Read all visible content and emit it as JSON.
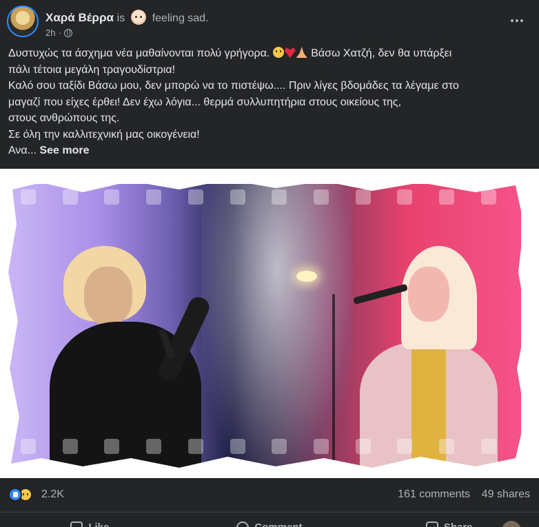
{
  "post": {
    "author": "Χαρά Βέρρα",
    "is_text": "is",
    "feeling_icon": "pleading-face",
    "feeling": "feeling sad.",
    "time": "2h",
    "privacy_icon": "globe-icon",
    "more_icon": "more-dots-icon",
    "text": {
      "line1a": "Δυστυχώς τα άσχημα νέα μαθαίνονται πολύ γρήγορα.",
      "line1b": "Βάσω Χατζή, δεν θα υπάρξει",
      "line2": "πάλι τέτοια μεγάλη τραγουδίστρια!",
      "line3": "Καλό σου ταξίδι Βάσω μου, δεν μπορώ να το πιστέψω.... Πριν λίγες βδομάδες τα λέγαμε στο",
      "line4": "μαγαζί που είχες έρθει! Δεν έχω λόγια... θερμά συλλυπητήρια στους οικείους της,",
      "line5": "στους ανθρώπους της.",
      "line6": "Σε όλη την καλλιτεχνική μας οικογένεια!",
      "line7": "Ανα...",
      "see_more": "See more"
    }
  },
  "stats": {
    "reactions": "2.2K",
    "reaction_types": [
      "like",
      "sad"
    ],
    "comments": "161 comments",
    "shares": "49 shares"
  },
  "actions": {
    "like": "Like",
    "comment": "Comment",
    "share": "Share"
  },
  "colors": {
    "background": "#242526",
    "text_primary": "#e4e6eb",
    "text_secondary": "#b0b3b8",
    "accent": "#2d88ff"
  }
}
